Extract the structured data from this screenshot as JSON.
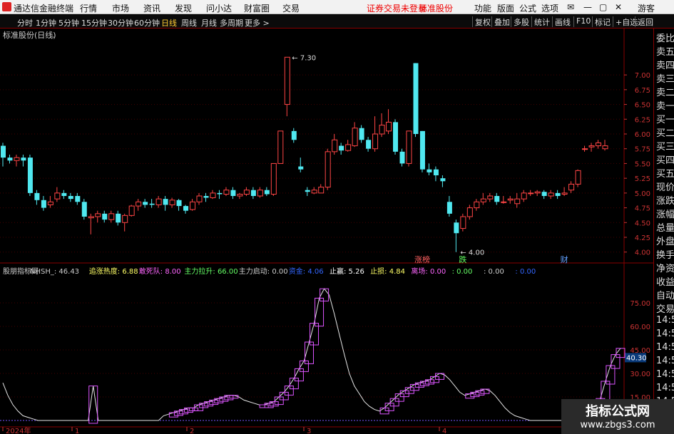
{
  "menubar": {
    "app_title": "通达信金融终端",
    "menus": [
      "行情",
      "市场",
      "资讯",
      "发现",
      "问小达",
      "财富圈",
      "交易"
    ],
    "notice": "证券交易未登录",
    "stock": "标准股份",
    "right": [
      "功能",
      "版面",
      "公式",
      "选项"
    ],
    "user": "游客"
  },
  "toolbar": {
    "periods": [
      "分时",
      "1分钟",
      "5分钟",
      "15分钟",
      "30分钟",
      "60分钟",
      "日线",
      "周线",
      "月线",
      "多周期",
      "更多 >"
    ],
    "active": "日线",
    "buttons": [
      "复权",
      "叠加",
      "多股",
      "统计",
      "画线",
      "F10",
      "标记",
      "+自选",
      "返回"
    ]
  },
  "chart": {
    "title": "标准股份(日线)",
    "high_label": "7.30",
    "low_label": "4.00",
    "y_ticks": [
      "7.00",
      "6.75",
      "6.50",
      "6.25",
      "6.00",
      "5.75",
      "5.50",
      "5.25",
      "5.00",
      "4.75",
      "4.50",
      "4.25",
      "4.00"
    ],
    "markers": [
      {
        "text": "涨榜",
        "color": "#ff6060"
      },
      {
        "text": "跌",
        "color": "#60ff60"
      },
      {
        "text": "财",
        "color": "#60a0ff"
      }
    ]
  },
  "indicator": {
    "legend": [
      {
        "text": "股朋指标网",
        "color": "#cccccc"
      },
      {
        "text": "NHSH_: 46.43",
        "color": "#cccccc"
      },
      {
        "text": "追涨热度: 6.88",
        "color": "#ffff66"
      },
      {
        "text": "敢死队: 8.00",
        "color": "#ff66ff"
      },
      {
        "text": "主力拉升: 66.00",
        "color": "#66ff66"
      },
      {
        "text": "主力启动: 0.00",
        "color": "#cccccc"
      },
      {
        "text": "资金: 4.06",
        "color": "#3366ff"
      },
      {
        "text": "止赢: 5.26",
        "color": "#ffffff"
      },
      {
        "text": "止损: 4.84",
        "color": "#ffff66"
      },
      {
        "text": "离场: 0.00",
        "color": "#ff66ff"
      },
      {
        "text": ": 0.00",
        "color": "#66ff66"
      },
      {
        "text": ": 0.00",
        "color": "#cccccc"
      },
      {
        "text": ": 0.00",
        "color": "#3366ff"
      }
    ],
    "y_ticks": [
      "75.00",
      "60.00",
      "45.00",
      "30.00",
      "15.00"
    ],
    "current": "40.30"
  },
  "x_axis": {
    "labels": [
      "2024年",
      "1",
      "2",
      "3",
      "4"
    ]
  },
  "right_panel": {
    "items": [
      "委比",
      "卖五",
      "卖四",
      "卖三",
      "卖二",
      "卖一",
      "买一",
      "买二",
      "买三",
      "买四",
      "买五",
      "现价",
      "涨跌",
      "涨幅",
      "总量",
      "外盘",
      "换手",
      "净资",
      "收益",
      "自动",
      "交易",
      "14:5",
      "14:5",
      "14:5",
      "14:5",
      "14:5",
      "14:5",
      "14:5",
      "14:5",
      "14:5"
    ]
  },
  "watermark": {
    "line1": "指标公式网",
    "line2": "www.zbgs3.com"
  },
  "chart_data": {
    "type": "candlestick",
    "y_range": [
      3.9,
      7.4
    ],
    "candles": [
      [
        5.8,
        5.6,
        5.85,
        5.45
      ],
      [
        5.6,
        5.55,
        5.65,
        5.5
      ],
      [
        5.55,
        5.6,
        5.65,
        5.45
      ],
      [
        5.6,
        5.55,
        5.65,
        5.45
      ],
      [
        5.6,
        5.0,
        5.65,
        4.95
      ],
      [
        5.0,
        4.88,
        5.05,
        4.8
      ],
      [
        4.88,
        4.75,
        4.95,
        4.7
      ],
      [
        4.8,
        4.85,
        4.95,
        4.75
      ],
      [
        4.9,
        5.0,
        5.1,
        4.85
      ],
      [
        5.0,
        4.95,
        5.05,
        4.9
      ],
      [
        4.95,
        4.9,
        5.0,
        4.85
      ],
      [
        4.95,
        4.85,
        5.0,
        4.8
      ],
      [
        4.85,
        4.6,
        4.9,
        4.55
      ],
      [
        4.58,
        4.6,
        4.65,
        4.3
      ],
      [
        4.6,
        4.65,
        4.7,
        4.5
      ],
      [
        4.65,
        4.55,
        4.7,
        4.5
      ],
      [
        4.55,
        4.65,
        4.7,
        4.5
      ],
      [
        4.65,
        4.5,
        4.7,
        4.45
      ],
      [
        4.5,
        4.62,
        4.65,
        4.35
      ],
      [
        4.62,
        4.78,
        4.8,
        4.6
      ],
      [
        4.78,
        4.85,
        4.9,
        4.7
      ],
      [
        4.85,
        4.8,
        4.9,
        4.75
      ],
      [
        4.82,
        4.8,
        4.9,
        4.75
      ],
      [
        4.8,
        4.9,
        4.95,
        4.75
      ],
      [
        4.9,
        4.8,
        4.95,
        4.7
      ],
      [
        4.8,
        4.88,
        4.92,
        4.75
      ],
      [
        4.88,
        4.78,
        4.9,
        4.7
      ],
      [
        4.78,
        4.7,
        4.8,
        4.65
      ],
      [
        4.72,
        4.85,
        4.9,
        4.7
      ],
      [
        4.85,
        4.95,
        5.0,
        4.8
      ],
      [
        4.95,
        4.92,
        5.0,
        4.85
      ],
      [
        4.92,
        5.0,
        5.05,
        4.9
      ],
      [
        5.0,
        4.98,
        5.05,
        4.9
      ],
      [
        4.98,
        5.05,
        5.1,
        4.95
      ],
      [
        5.05,
        4.95,
        5.1,
        4.9
      ],
      [
        4.95,
        4.98,
        5.0,
        4.9
      ],
      [
        4.98,
        5.05,
        5.1,
        4.95
      ],
      [
        5.05,
        4.95,
        5.1,
        4.9
      ],
      [
        4.95,
        5.05,
        5.1,
        4.92
      ],
      [
        5.05,
        4.98,
        5.1,
        4.95
      ],
      [
        4.98,
        5.5,
        5.5,
        4.95
      ],
      [
        5.5,
        6.05,
        6.05,
        5.6
      ],
      [
        6.5,
        7.3,
        7.3,
        6.3
      ],
      [
        6.05,
        5.9,
        6.1,
        5.85
      ],
      [
        5.45,
        5.4,
        5.6,
        5.35
      ],
      [
        5.05,
        5.02,
        5.1,
        4.95
      ],
      [
        5.0,
        5.05,
        5.1,
        4.98
      ],
      [
        5.0,
        5.1,
        5.15,
        5.0
      ],
      [
        5.1,
        5.7,
        5.75,
        5.05
      ],
      [
        5.7,
        5.9,
        6.0,
        5.65
      ],
      [
        5.8,
        5.72,
        5.85,
        5.65
      ],
      [
        5.72,
        5.82,
        5.9,
        5.7
      ],
      [
        5.8,
        6.1,
        6.2,
        5.78
      ],
      [
        6.1,
        5.9,
        6.15,
        5.85
      ],
      [
        5.9,
        5.75,
        5.95,
        5.7
      ],
      [
        5.75,
        6.0,
        6.3,
        5.7
      ],
      [
        6.0,
        6.15,
        6.35,
        5.95
      ],
      [
        6.05,
        6.2,
        6.42,
        6.0
      ],
      [
        6.2,
        5.7,
        6.25,
        5.65
      ],
      [
        5.7,
        5.5,
        5.75,
        5.45
      ],
      [
        5.5,
        6.05,
        6.05,
        5.45
      ],
      [
        7.2,
        6.0,
        7.2,
        5.95
      ],
      [
        6.05,
        5.4,
        6.05,
        5.35
      ],
      [
        5.4,
        5.35,
        5.5,
        5.3
      ],
      [
        5.4,
        5.3,
        5.45,
        5.2
      ],
      [
        5.25,
        5.2,
        5.3,
        5.1
      ],
      [
        4.85,
        4.65,
        4.95,
        4.6
      ],
      [
        4.5,
        4.32,
        4.55,
        4.0
      ],
      [
        4.4,
        4.6,
        4.65,
        4.35
      ],
      [
        4.6,
        4.75,
        4.8,
        4.55
      ],
      [
        4.75,
        4.85,
        4.9,
        4.7
      ],
      [
        4.85,
        4.9,
        5.0,
        4.8
      ],
      [
        4.9,
        4.95,
        5.0,
        4.85
      ],
      [
        4.95,
        4.85,
        5.0,
        4.8
      ],
      [
        4.85,
        4.85,
        4.95,
        4.82
      ],
      [
        4.88,
        4.9,
        4.95,
        4.82
      ],
      [
        4.82,
        4.9,
        5.0,
        4.75
      ],
      [
        4.9,
        5.0,
        5.05,
        4.85
      ],
      [
        5.0,
        5.0,
        5.05,
        4.95
      ],
      [
        5.0,
        5.02,
        5.05,
        4.95
      ],
      [
        5.02,
        4.95,
        5.05,
        4.9
      ],
      [
        4.95,
        5.0,
        5.05,
        4.9
      ],
      [
        5.0,
        4.95,
        5.05,
        4.9
      ],
      [
        4.98,
        5.0,
        5.1,
        4.95
      ],
      [
        5.05,
        5.15,
        5.2,
        5.0
      ],
      [
        5.15,
        5.38,
        5.4,
        5.1
      ],
      [
        5.75,
        5.75,
        5.8,
        5.7
      ],
      [
        5.78,
        5.8,
        5.85,
        5.7
      ],
      [
        5.8,
        5.85,
        5.9,
        5.75
      ],
      [
        5.75,
        5.8,
        5.9,
        5.72
      ]
    ],
    "indicator_line": [
      24,
      16,
      10,
      6,
      3,
      2,
      1,
      0,
      0,
      0,
      0,
      0,
      0,
      0,
      0,
      0,
      0,
      0,
      22,
      0,
      0,
      0,
      0,
      0,
      0,
      0,
      0,
      0,
      0,
      0,
      0,
      0,
      3,
      4,
      5,
      6,
      7,
      8,
      8,
      10,
      11,
      12,
      13,
      14,
      15,
      16,
      16,
      15,
      13,
      12,
      11,
      10,
      10,
      11,
      12,
      15,
      18,
      22,
      27,
      33,
      38,
      50,
      62,
      78,
      84,
      80,
      68,
      55,
      42,
      30,
      22,
      17,
      12,
      9,
      7,
      6,
      8,
      11,
      14,
      17,
      19,
      21,
      23,
      24,
      25,
      26,
      28,
      30,
      29,
      26,
      22,
      18,
      16,
      17,
      18,
      19,
      20,
      19,
      16,
      12,
      8,
      5,
      3,
      2,
      1,
      0,
      0,
      0,
      0,
      0,
      0,
      0,
      0,
      0,
      0,
      0,
      0,
      2,
      6,
      14,
      25,
      35,
      42,
      46
    ]
  }
}
